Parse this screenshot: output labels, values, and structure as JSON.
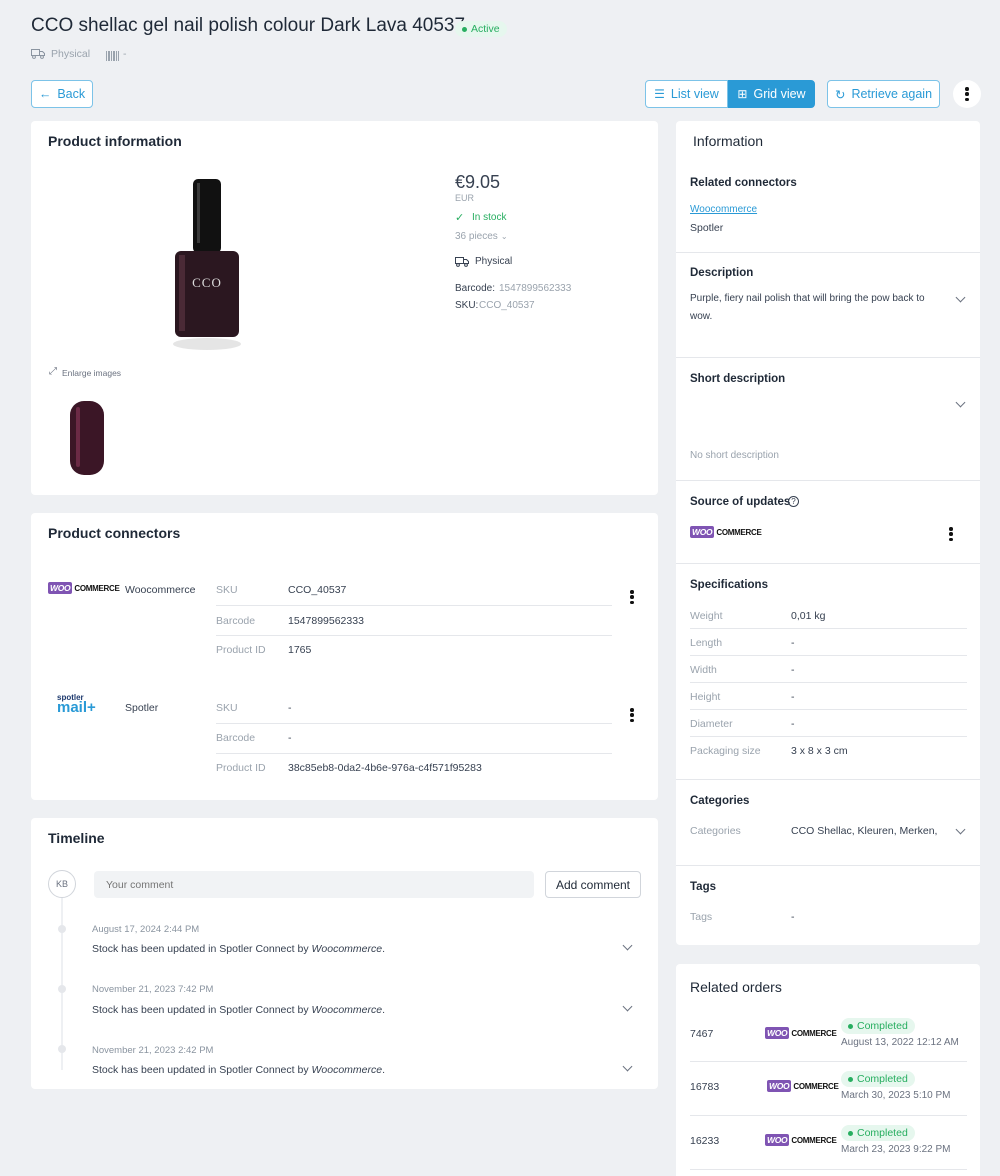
{
  "header": {
    "title": "CCO shellac gel nail polish colour Dark Lava 40537",
    "status": "Active",
    "type_label": "Physical",
    "barcode_label": "-"
  },
  "toolbar": {
    "back": "Back",
    "list_view": "List view",
    "grid_view": "Grid view",
    "retrieve": "Retrieve again"
  },
  "product_info": {
    "title": "Product information",
    "price": "€9.05",
    "currency": "EUR",
    "stock": "In stock",
    "pieces": "36 pieces",
    "type": "Physical",
    "barcode_label": "Barcode:",
    "barcode": "1547899562333",
    "sku_label": "SKU:",
    "sku": "CCO_40537",
    "enlarge": "Enlarge images",
    "bottle_brand": "CCO"
  },
  "connectors": {
    "title": "Product connectors",
    "items": [
      {
        "name": "Woocommerce",
        "logo": "WOO COMMERCE",
        "rows": [
          {
            "label": "SKU",
            "value": "CCO_40537"
          },
          {
            "label": "Barcode",
            "value": "1547899562333"
          },
          {
            "label": "Product ID",
            "value": "1765"
          }
        ]
      },
      {
        "name": "Spotler",
        "logo_top": "spotler",
        "logo_bottom": "mail+",
        "rows": [
          {
            "label": "SKU",
            "value": "-"
          },
          {
            "label": "Barcode",
            "value": "-"
          },
          {
            "label": "Product ID",
            "value": "38c85eb8-0da2-4b6e-976a-c4f571f95283"
          }
        ]
      }
    ]
  },
  "timeline": {
    "title": "Timeline",
    "avatar": "KB",
    "placeholder": "Your comment",
    "add_comment": "Add comment",
    "entries": [
      {
        "date": "August 17, 2024 2:44 PM",
        "text": "Stock has been updated in Spotler Connect by ",
        "by": "Woocommerce",
        "end": "."
      },
      {
        "date": "November 21, 2023 7:42 PM",
        "text": "Stock has been updated in Spotler Connect by ",
        "by": "Woocommerce",
        "end": "."
      },
      {
        "date": "November 21, 2023 2:42 PM",
        "text": "Stock has been updated in Spotler Connect by ",
        "by": "Woocommerce",
        "end": "."
      }
    ]
  },
  "information": {
    "title": "Information",
    "related_connectors": {
      "title": "Related connectors",
      "link": "Woocommerce",
      "other": "Spotler"
    },
    "description": {
      "title": "Description",
      "line1": "Purple, fiery nail polish that will bring the pow back to",
      "line2": "wow."
    },
    "short_description": {
      "title": "Short description",
      "empty": "No short description"
    },
    "source": {
      "title": "Source of updates",
      "help": "?",
      "logo": "WOO COMMERCE"
    },
    "specifications": {
      "title": "Specifications",
      "rows": [
        {
          "label": "Weight",
          "value": "0,01 kg"
        },
        {
          "label": "Length",
          "value": "-"
        },
        {
          "label": "Width",
          "value": "-"
        },
        {
          "label": "Height",
          "value": "-"
        },
        {
          "label": "Diameter",
          "value": "-"
        },
        {
          "label": "Packaging size",
          "value": "3 x 8 x 3 cm"
        }
      ]
    },
    "categories": {
      "title": "Categories",
      "label": "Categories",
      "value": "CCO Shellac, Kleuren, Merken,"
    },
    "tags": {
      "title": "Tags",
      "label": "Tags",
      "value": "-"
    }
  },
  "related_orders": {
    "title": "Related orders",
    "orders": [
      {
        "id": "7467",
        "status": "Completed",
        "date": "August 13, 2022 12:12 AM"
      },
      {
        "id": "16783",
        "status": "Completed",
        "date": "March 30, 2023 5:10 PM"
      },
      {
        "id": "16233",
        "status": "Completed",
        "date": "March 23, 2023 9:22 PM"
      }
    ]
  },
  "colors": {
    "accent": "#2a9ad6",
    "success": "#27ae60",
    "woo": "#7f54b3"
  }
}
